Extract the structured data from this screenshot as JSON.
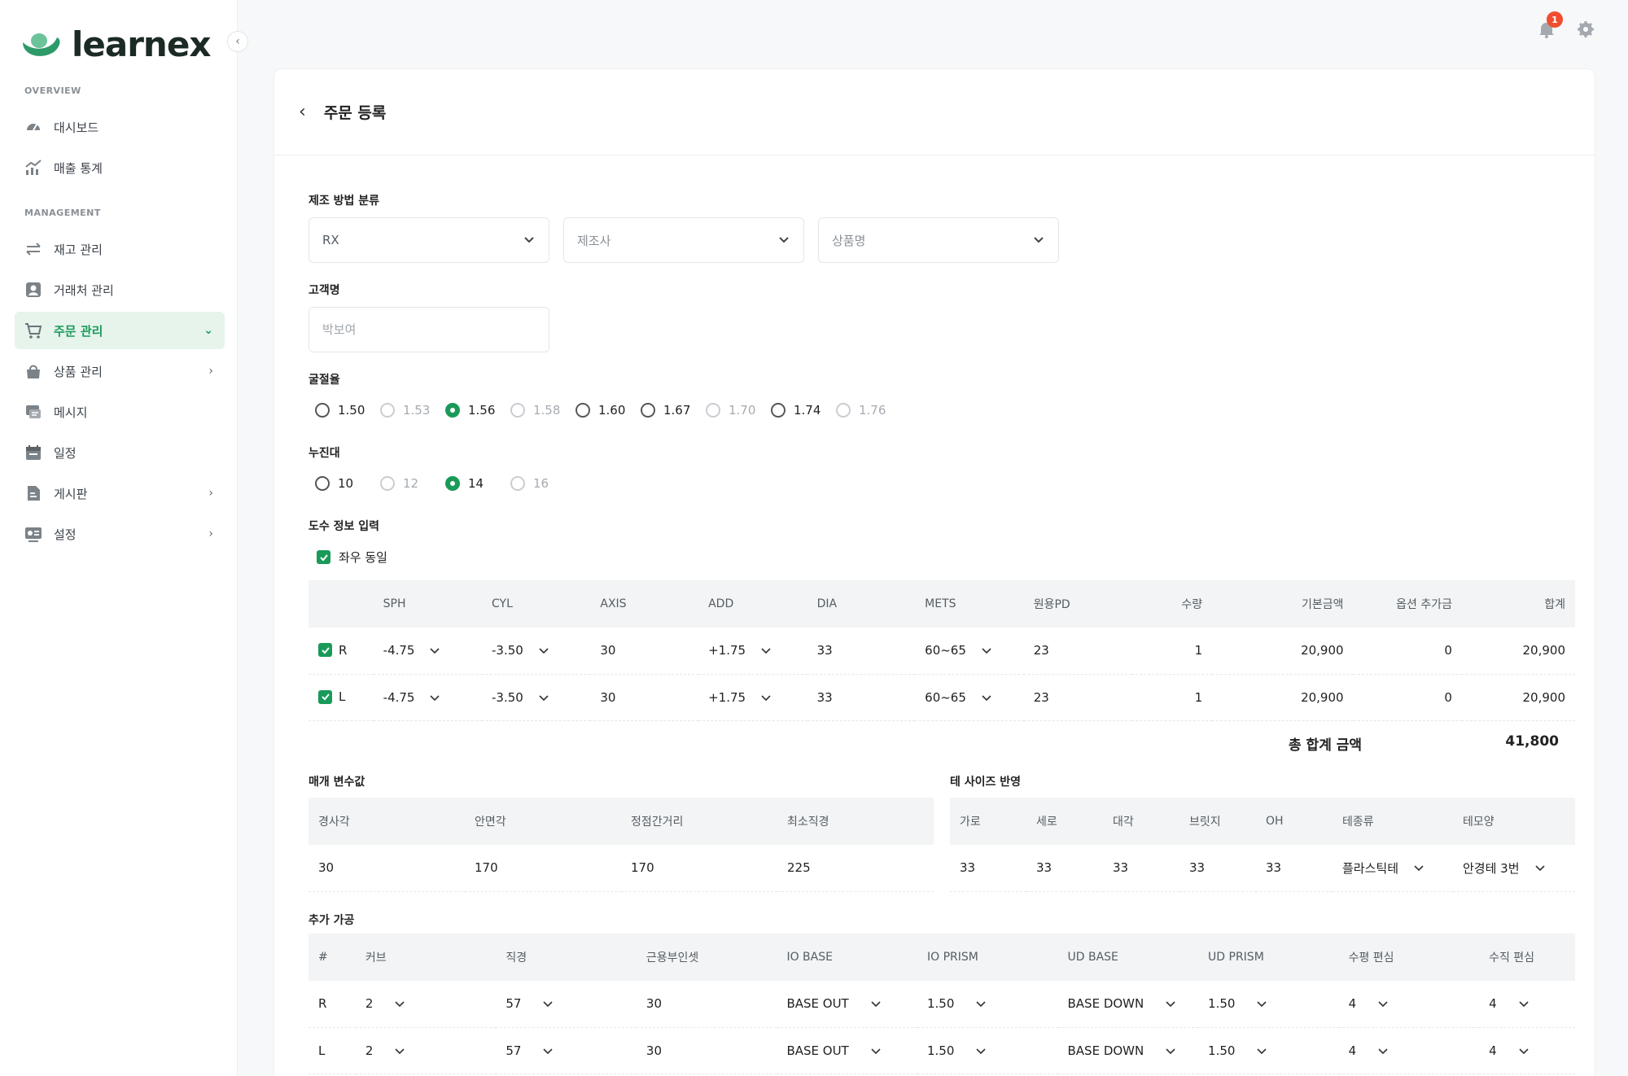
{
  "app": {
    "brand": "learnex",
    "notification_count": "1"
  },
  "sidebar": {
    "overview_title": "OVERVIEW",
    "management_title": "MANAGEMENT",
    "overview_items": [
      {
        "label": "대시보드",
        "icon": "dashboard-icon"
      },
      {
        "label": "매출 통계",
        "icon": "chart-icon"
      }
    ],
    "management_items": [
      {
        "label": "재고 관리",
        "icon": "transfer-icon"
      },
      {
        "label": "거래처 관리",
        "icon": "user-icon"
      },
      {
        "label": "주문 관리",
        "icon": "cart-icon",
        "active": true
      },
      {
        "label": "상품 관리",
        "icon": "bag-icon"
      },
      {
        "label": "메시지",
        "icon": "message-icon"
      },
      {
        "label": "일정",
        "icon": "calendar-icon"
      },
      {
        "label": "게시판",
        "icon": "board-icon"
      },
      {
        "label": "설정",
        "icon": "settings-icon"
      }
    ]
  },
  "page": {
    "title": "주문 등록"
  },
  "form": {
    "method_label": "제조 방법 분류",
    "method_select": "RX",
    "maker_placeholder": "제조사",
    "product_placeholder": "상품명",
    "customer_label": "고객명",
    "customer_placeholder": "박보여",
    "refraction_label": "굴절율",
    "refraction_options": [
      {
        "value": "1.50",
        "state": "normal"
      },
      {
        "value": "1.53",
        "state": "disabled"
      },
      {
        "value": "1.56",
        "state": "checked"
      },
      {
        "value": "1.58",
        "state": "disabled"
      },
      {
        "value": "1.60",
        "state": "normal"
      },
      {
        "value": "1.67",
        "state": "normal"
      },
      {
        "value": "1.70",
        "state": "disabled"
      },
      {
        "value": "1.74",
        "state": "normal"
      },
      {
        "value": "1.76",
        "state": "disabled"
      }
    ],
    "progressive_label": "누진대",
    "progressive_options": [
      {
        "value": "10",
        "state": "normal"
      },
      {
        "value": "12",
        "state": "disabled"
      },
      {
        "value": "14",
        "state": "checked"
      },
      {
        "value": "16",
        "state": "disabled"
      }
    ],
    "prescription_label": "도수 정보 입력",
    "same_lr_label": "좌우 동일"
  },
  "prescription_table": {
    "headers": [
      "",
      "SPH",
      "CYL",
      "AXIS",
      "ADD",
      "DIA",
      "METS",
      "원용PD",
      "수량",
      "기본금액",
      "옵션 추가금",
      "합계"
    ],
    "rows": [
      {
        "side": "R",
        "sph": "-4.75",
        "cyl": "-3.50",
        "axis": "30",
        "add": "+1.75",
        "dia": "33",
        "mets": "60~65",
        "pd": "23",
        "qty": "1",
        "base": "20,900",
        "option": "0",
        "sum": "20,900"
      },
      {
        "side": "L",
        "sph": "-4.75",
        "cyl": "-3.50",
        "axis": "30",
        "add": "+1.75",
        "dia": "33",
        "mets": "60~65",
        "pd": "23",
        "qty": "1",
        "base": "20,900",
        "option": "0",
        "sum": "20,900"
      }
    ],
    "total_label": "총 합계 금액",
    "total_value": "41,800"
  },
  "params": {
    "label": "매개 변수값",
    "headers": [
      "경사각",
      "안면각",
      "정점간거리",
      "최소직경"
    ],
    "values": [
      "30",
      "170",
      "170",
      "225"
    ]
  },
  "frame": {
    "label": "테 사이즈 반영",
    "headers": [
      "가로",
      "세로",
      "대각",
      "브릿지",
      "OH",
      "테종류",
      "테모양"
    ],
    "values": [
      "33",
      "33",
      "33",
      "33",
      "33",
      "플라스틱테",
      "안경테 3번"
    ]
  },
  "extra": {
    "label": "추가 가공",
    "headers": [
      "#",
      "커브",
      "직경",
      "근용부인셋",
      "IO BASE",
      "IO PRISM",
      "UD BASE",
      "UD PRISM",
      "수평 편심",
      "수직 편심"
    ],
    "rows": [
      {
        "side": "R",
        "curve": "2",
        "diameter": "57",
        "inset": "30",
        "io_base": "BASE OUT",
        "io_prism": "1.50",
        "ud_base": "BASE DOWN",
        "ud_prism": "1.50",
        "h": "4",
        "v": "4"
      },
      {
        "side": "L",
        "curve": "2",
        "diameter": "57",
        "inset": "30",
        "io_base": "BASE OUT",
        "io_prism": "1.50",
        "ud_base": "BASE DOWN",
        "ud_prism": "1.50",
        "h": "4",
        "v": "4"
      }
    ]
  },
  "colors": {
    "accent": "#1a9a59",
    "badge": "#f04e2e"
  }
}
